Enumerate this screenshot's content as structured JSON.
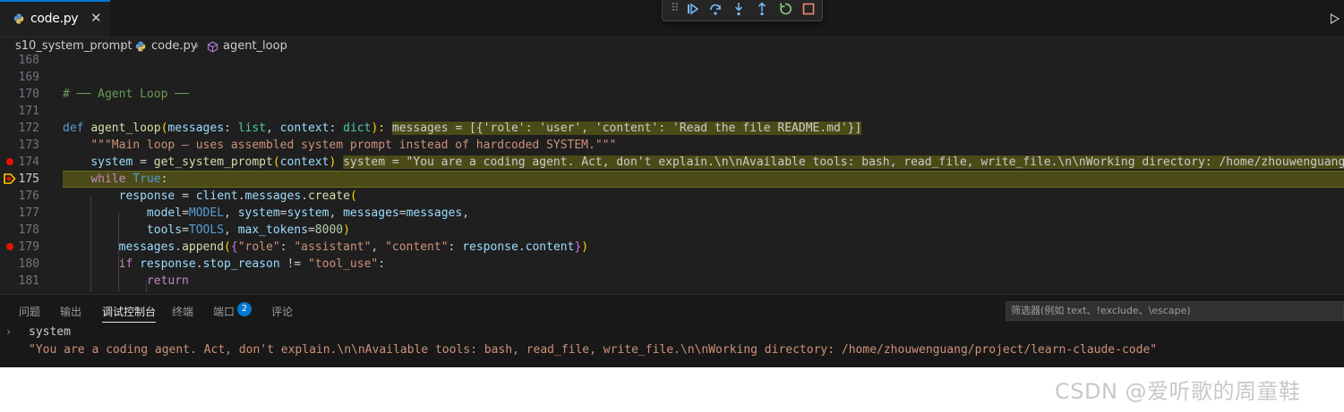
{
  "tab": {
    "title": "code.py",
    "close": "✕"
  },
  "breadcrumb": {
    "folder": "s10_system_prompt",
    "sep": "›",
    "file": "code.py",
    "symbol": "agent_loop"
  },
  "editor": {
    "lines": [
      {
        "n": "168"
      },
      {
        "n": "169"
      },
      {
        "n": "170",
        "t": [
          "# ── Agent Loop ──"
        ]
      },
      {
        "n": "171"
      },
      {
        "n": "172",
        "t": [
          "def",
          " ",
          "agent_loop",
          "(",
          "messages",
          ": ",
          "list",
          ", ",
          "context",
          ": ",
          "dict",
          "):",
          " ",
          "messages = [{'role': 'user', 'content': 'Read the file README.md'}]"
        ]
      },
      {
        "n": "173",
        "t": [
          "    ",
          "\"\"\"Main loop — uses assembled system prompt instead of hardcoded SYSTEM.\"\"\""
        ]
      },
      {
        "n": "174",
        "t": [
          "    ",
          "system",
          " = ",
          "get_system_prompt",
          "(",
          "context",
          ")",
          " ",
          "system = \"You are a coding agent. Act, don't explain.\\n\\nAvailable tools: bash, read_file, write_file.\\n\\nWorking directory: /home/zhouwenguang/pr"
        ]
      },
      {
        "n": "175",
        "t": [
          "    ",
          "while",
          " ",
          "True",
          ":"
        ]
      },
      {
        "n": "176",
        "t": [
          "        ",
          "response",
          " = ",
          "client",
          ".",
          "messages",
          ".",
          "create",
          "("
        ]
      },
      {
        "n": "177",
        "t": [
          "            ",
          "model",
          "=",
          "MODEL",
          ", ",
          "system",
          "=",
          "system",
          ", ",
          "messages",
          "=",
          "messages",
          ","
        ]
      },
      {
        "n": "178",
        "t": [
          "            ",
          "tools",
          "=",
          "TOOLS",
          ", ",
          "max_tokens",
          "=",
          "8000",
          ")"
        ]
      },
      {
        "n": "179",
        "t": [
          "        ",
          "messages",
          ".",
          "append",
          "(",
          "{",
          "\"role\"",
          ": ",
          "\"assistant\"",
          ", ",
          "\"content\"",
          ": ",
          "response",
          ".",
          "content",
          "}",
          ")"
        ]
      },
      {
        "n": "180",
        "t": [
          "        ",
          "if",
          " ",
          "response",
          ".",
          "stop_reason",
          " != ",
          "\"tool_use\"",
          ":"
        ]
      },
      {
        "n": "181",
        "t": [
          "            ",
          "return"
        ]
      }
    ]
  },
  "panel": {
    "tabs": [
      "问题",
      "输出",
      "调试控制台",
      "终端",
      "端口",
      "评论"
    ],
    "ports_badge": "2",
    "filter_placeholder": "筛选器(例如 text、!exclude、\\escape)"
  },
  "console": {
    "prompt": "›",
    "input": "system",
    "output": "\"You are a coding agent. Act, don't explain.\\n\\nAvailable tools: bash, read_file, write_file.\\n\\nWorking directory: /home/zhouwenguang/project/learn-claude-code\""
  },
  "watermark": "CSDN @爱听歌的周童鞋",
  "colors": {
    "accent": "#0078d4",
    "breakpoint": "#e51400",
    "highlight": "#4b4b18",
    "editor_bg": "#1f1f1f"
  }
}
